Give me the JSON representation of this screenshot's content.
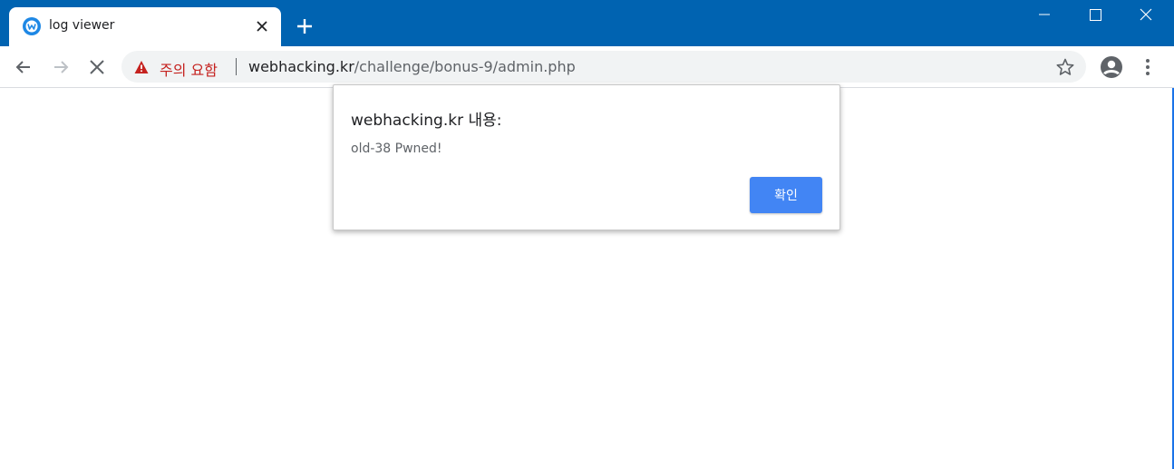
{
  "browser": {
    "tab": {
      "title": "log viewer"
    },
    "omnibox": {
      "security_label": "주의 요함",
      "url_host": "webhacking.kr",
      "url_path": "/challenge/bonus-9/admin.php"
    }
  },
  "dialog": {
    "title": "webhacking.kr 내용:",
    "message": "old-38 Pwned!",
    "ok_label": "확인"
  },
  "colors": {
    "titlebar": "#0063b1",
    "warning": "#c5221f",
    "button": "#4285f4"
  },
  "icons": [
    "favicon-icon",
    "close-icon",
    "plus-icon",
    "minimize-icon",
    "maximize-icon",
    "close-window-icon",
    "back-arrow-icon",
    "forward-arrow-icon",
    "stop-icon",
    "warning-icon",
    "star-icon",
    "profile-icon",
    "menu-icon"
  ]
}
